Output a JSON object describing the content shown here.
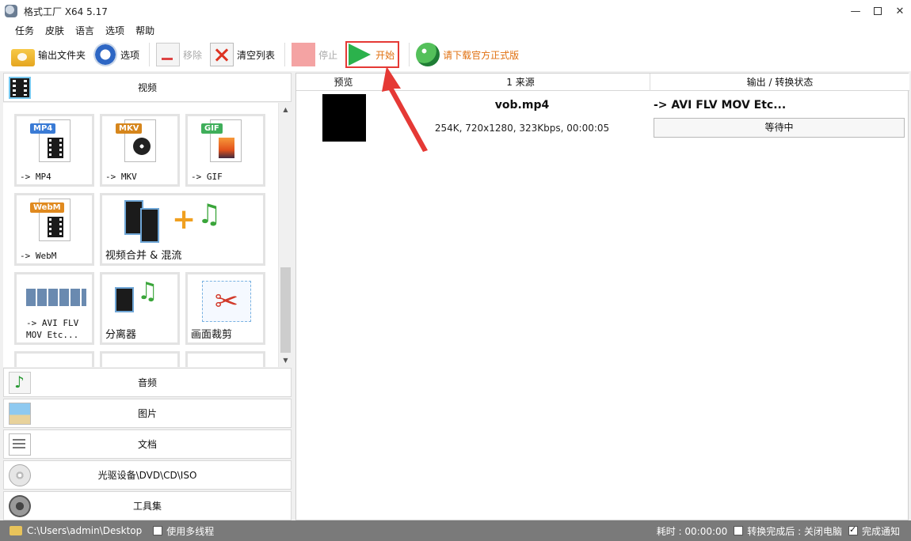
{
  "window": {
    "title": "格式工厂 X64 5.17",
    "minimize": "—",
    "maximize": "",
    "close": "✕"
  },
  "menu": [
    "任务",
    "皮肤",
    "语言",
    "选项",
    "帮助"
  ],
  "toolbar": {
    "output_folder": "输出文件夹",
    "options": "选项",
    "remove": "移除",
    "clear_list": "清空列表",
    "stop": "停止",
    "start": "开始",
    "download": "请下载官方正式版"
  },
  "categories": {
    "video": "视频",
    "audio": "音频",
    "picture": "图片",
    "document": "文档",
    "disc": "光驱设备\\DVD\\CD\\ISO",
    "tools": "工具集"
  },
  "tiles": {
    "mp4": {
      "badge": "MP4",
      "label": "-> MP4"
    },
    "mkv": {
      "badge": "MKV",
      "label": "-> MKV"
    },
    "gif": {
      "badge": "GIF",
      "label": "-> GIF"
    },
    "webm": {
      "badge": "WebM",
      "label": "-> WebM"
    },
    "merge": {
      "label": "视频合并 & 混流"
    },
    "avi": {
      "label": "-> AVI FLV\nMOV Etc..."
    },
    "splitter": {
      "label": "分离器"
    },
    "crop": {
      "label": "画面裁剪"
    }
  },
  "list": {
    "headers": {
      "preview": "预览",
      "source": "1 来源",
      "output": "输出 / 转换状态"
    },
    "rows": [
      {
        "name": "vob.mp4",
        "info": "254K, 720x1280, 323Kbps, 00:00:05",
        "output_format": "-> AVI FLV MOV Etc...",
        "status": "等待中"
      }
    ]
  },
  "statusbar": {
    "path": "C:\\Users\\admin\\Desktop",
    "multithread": "使用多线程",
    "elapsed": "耗时 : 00:00:00",
    "after_done": "转换完成后 : 关闭电脑",
    "notify": "完成通知"
  },
  "colors": {
    "accent_red": "#e53935",
    "start_green": "#2bb24c",
    "download_orange": "#e07010",
    "statusbar": "#7a7a7a"
  }
}
